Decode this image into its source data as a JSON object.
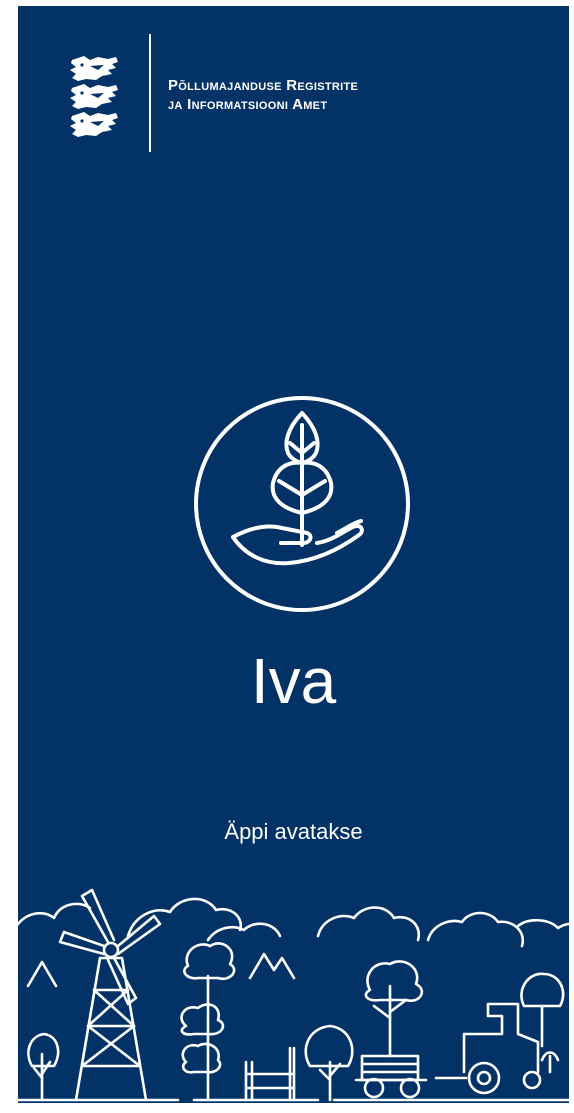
{
  "header": {
    "agency_line1": "Põllumajanduse Registrite",
    "agency_line2": "ja Informatsiooni Amet",
    "coat_of_arms": "estonian-coat-of-arms"
  },
  "splash": {
    "app_name": "Iva",
    "status_text": "Äppi avatakse",
    "logo_icon": "wheat-in-hand-icon",
    "illustration": "rural-landscape-illustration"
  },
  "colors": {
    "background": "#033366",
    "foreground": "#ffffff"
  }
}
